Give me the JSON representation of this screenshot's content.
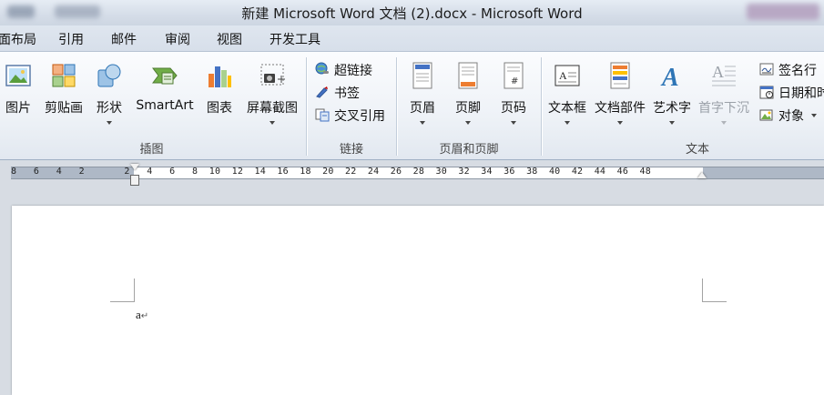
{
  "window": {
    "title": "新建 Microsoft Word 文档 (2).docx - Microsoft Word"
  },
  "menu": {
    "tabs": [
      "面布局",
      "引用",
      "邮件",
      "审阅",
      "视图",
      "开发工具"
    ]
  },
  "ribbon": {
    "groups": {
      "illustrations": {
        "label": "插图",
        "buttons": {
          "picture": "图片",
          "clipart": "剪贴画",
          "shapes": "形状",
          "smartart": "SmartArt",
          "chart": "图表",
          "screenshot": "屏幕截图"
        }
      },
      "links": {
        "label": "链接",
        "buttons": {
          "hyperlink": "超链接",
          "bookmark": "书签",
          "crossref": "交叉引用"
        }
      },
      "header_footer": {
        "label": "页眉和页脚",
        "buttons": {
          "header": "页眉",
          "footer": "页脚",
          "page_number": "页码"
        }
      },
      "text": {
        "label": "文本",
        "buttons": {
          "textbox": "文本框",
          "quickparts": "文档部件",
          "wordart": "艺术字",
          "dropcap": "首字下沉",
          "signature": "签名行",
          "datetime": "日期和时",
          "object": "对象"
        }
      }
    }
  },
  "ruler": {
    "labels": "8   6   4   2       2   4   6   8  10  12  14  16  18  20  22  24  26  28  30  32  34  36  38  40  42  44  46  48"
  },
  "document": {
    "text": "a"
  },
  "colors": {
    "ribbon_bg": "#eef2f7",
    "titlebar_bg": "#d5dde8",
    "page_bg": "#ffffff",
    "workspace_bg": "#d7dce3"
  }
}
